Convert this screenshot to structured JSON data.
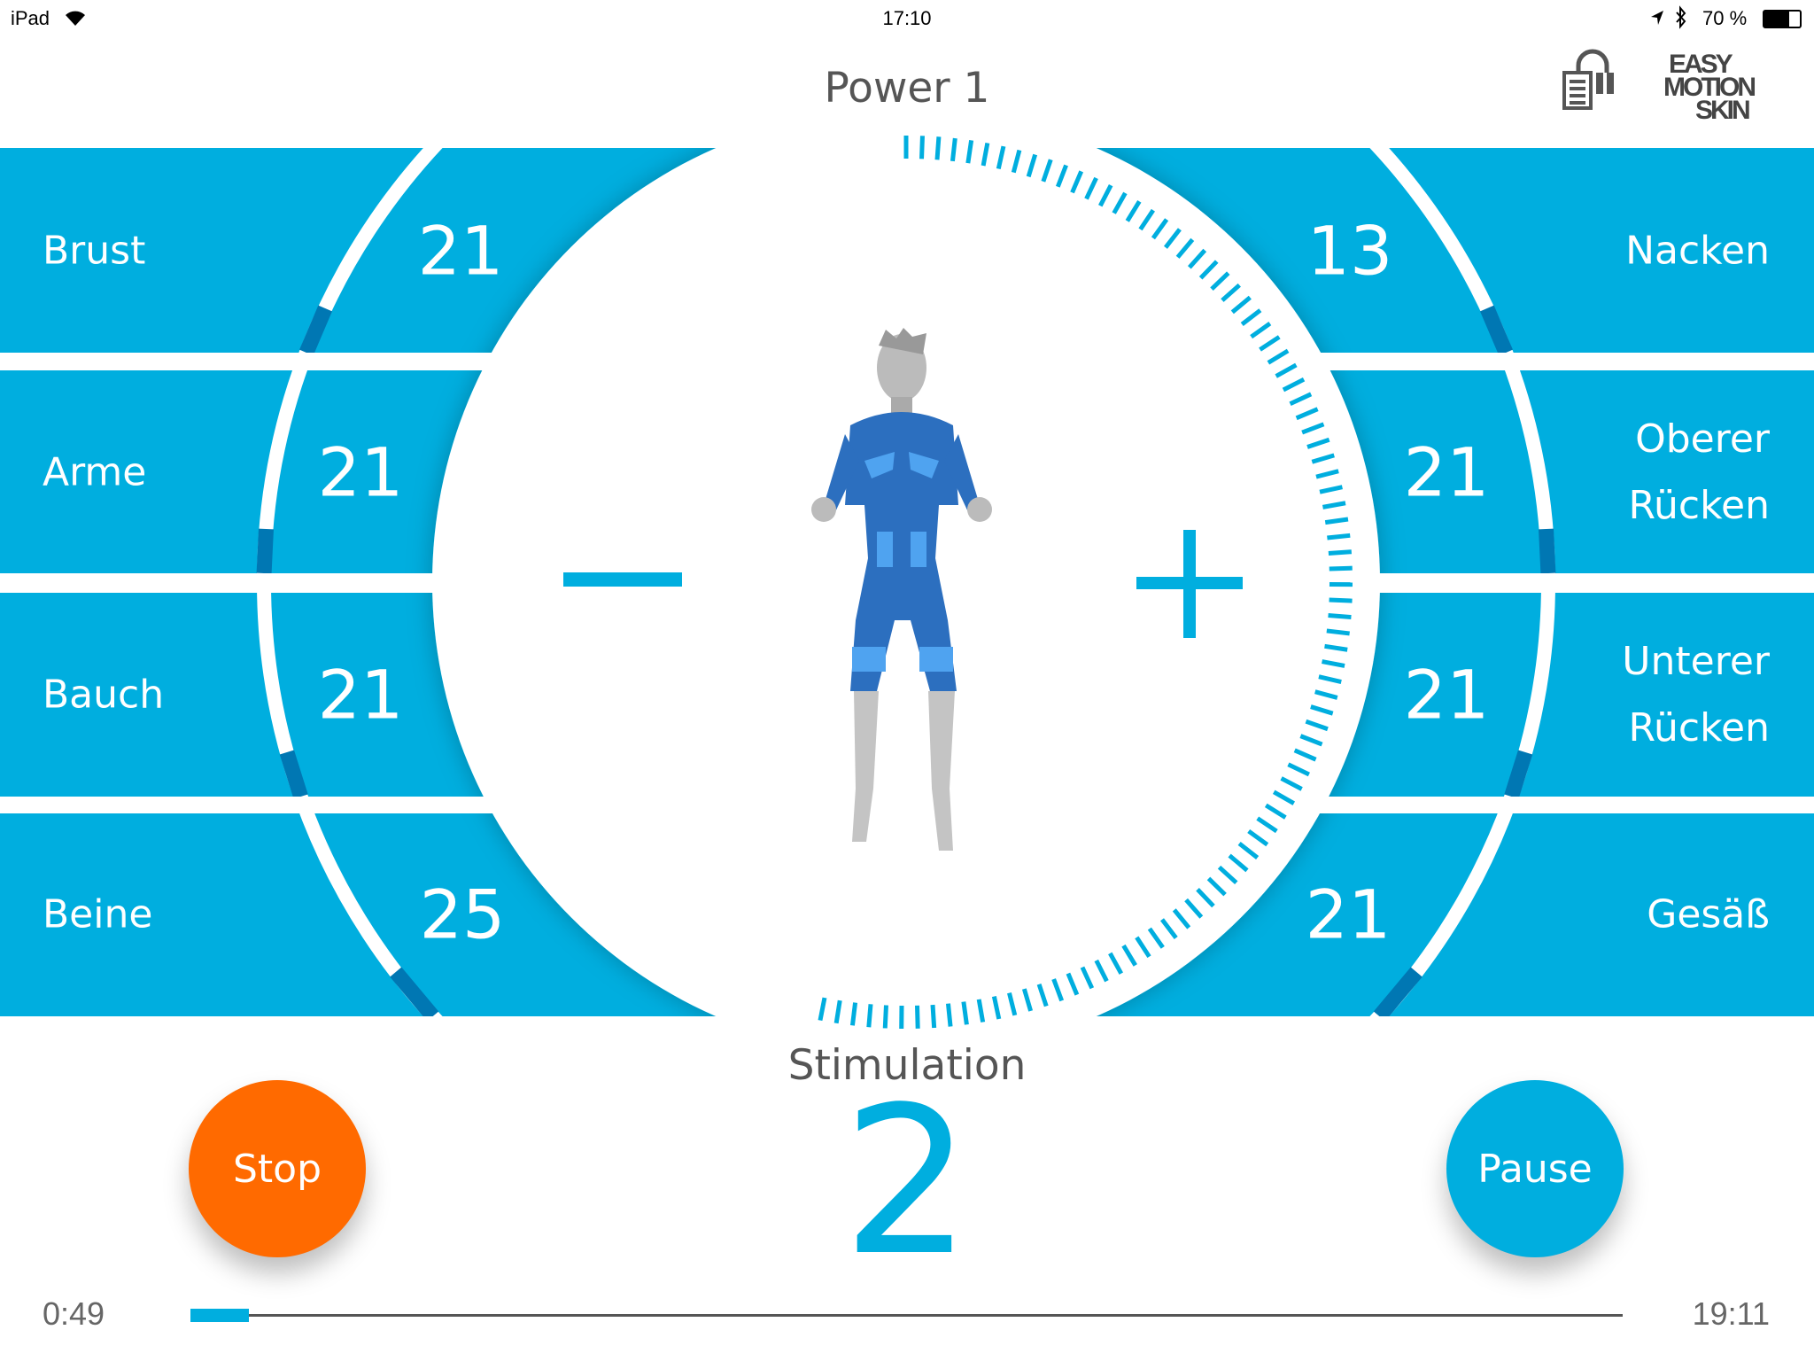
{
  "status_bar": {
    "device": "iPad",
    "time": "17:10",
    "battery": "70 %",
    "icons": [
      "wifi-icon",
      "location-icon",
      "bluetooth-icon",
      "battery-icon"
    ]
  },
  "header": {
    "title": "Power 1",
    "logo": "EASY MOTION SKIN",
    "device_icon": "suit-battery-icon"
  },
  "colors": {
    "accent": "#00AEDF",
    "accent_dark": "#0077B3",
    "stop": "#FF6A00",
    "text": "#555555"
  },
  "left_zones": [
    {
      "label": "Brust",
      "value": "21"
    },
    {
      "label": "Arme",
      "value": "21"
    },
    {
      "label": "Bauch",
      "value": "21"
    },
    {
      "label": "Beine",
      "value": "25"
    }
  ],
  "right_zones": [
    {
      "label": "Nacken",
      "value": "13"
    },
    {
      "label": "Oberer Rücken",
      "value": "21"
    },
    {
      "label": "Unterer Rücken",
      "value": "21"
    },
    {
      "label": "Gesäß",
      "value": "21"
    }
  ],
  "controls": {
    "minus": "−",
    "plus": "+",
    "stop_label": "Stop",
    "pause_label": "Pause"
  },
  "stimulation": {
    "label": "Stimulation",
    "value": "2"
  },
  "progress": {
    "elapsed": "0:49",
    "remaining": "19:11",
    "fraction": 0.041
  }
}
